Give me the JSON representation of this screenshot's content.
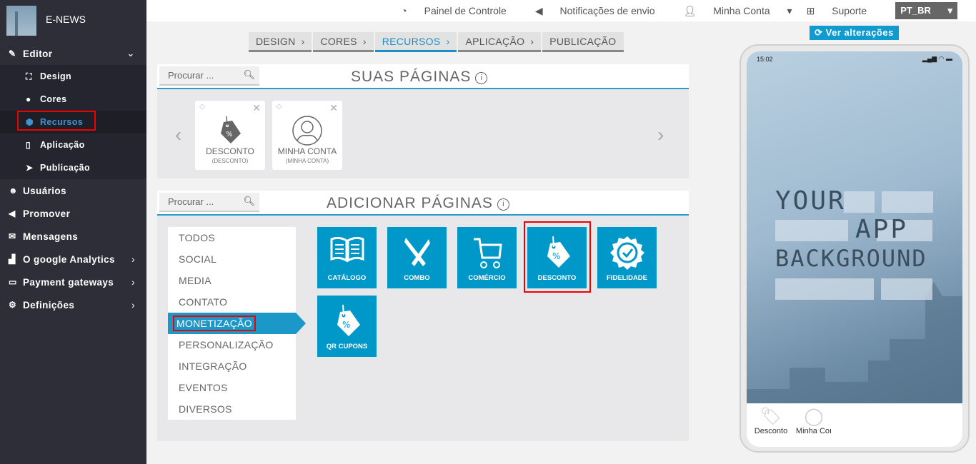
{
  "app": {
    "name": "E-NEWS"
  },
  "sidebar": {
    "items": [
      {
        "label": "Editor",
        "icon": "pencil-icon",
        "expanded": true,
        "children": [
          {
            "label": "Design",
            "icon": "crop-icon"
          },
          {
            "label": "Cores",
            "icon": "palette-icon"
          },
          {
            "label": "Recursos",
            "icon": "cube-icon",
            "active": true
          },
          {
            "label": "Aplicação",
            "icon": "mobile-icon"
          },
          {
            "label": "Publicação",
            "icon": "paper-plane-icon"
          }
        ]
      },
      {
        "label": "Usuários",
        "icon": "users-icon"
      },
      {
        "label": "Promover",
        "icon": "bullhorn-icon"
      },
      {
        "label": "Mensagens",
        "icon": "envelope-icon"
      },
      {
        "label": "O google Analytics",
        "icon": "bar-chart-icon",
        "chevron": true
      },
      {
        "label": "Payment gateways",
        "icon": "credit-card-icon",
        "chevron": true
      },
      {
        "label": "Definições",
        "icon": "cogs-icon",
        "chevron": true
      }
    ]
  },
  "topbar": {
    "panel": "Painel de Controle",
    "notifications": "Notificações de envio",
    "account": "Minha Conta",
    "support": "Suporte",
    "language": "PT_BR"
  },
  "breadcrumb": [
    "DESIGN",
    "CORES",
    "RECURSOS",
    "APLICAÇÃO",
    "PUBLICAÇÃO"
  ],
  "breadcrumb_active": "RECURSOS",
  "your_pages": {
    "title": "SUAS PÁGINAS",
    "search_placeholder": "Procurar ...",
    "pages": [
      {
        "title": "DESCONTO",
        "subtitle": "(DESCONTO)",
        "icon": "discount-tag-icon"
      },
      {
        "title": "MINHA CONTA",
        "subtitle": "(MINHA CONTA)",
        "icon": "user-circle-icon"
      }
    ]
  },
  "add_pages": {
    "title": "ADICIONAR PÁGINAS",
    "search_placeholder": "Procurar ...",
    "categories": [
      "TODOS",
      "SOCIAL",
      "MEDIA",
      "CONTATO",
      "MONETIZAÇÃO",
      "PERSONALIZAÇÃO",
      "INTEGRAÇÃO",
      "EVENTOS",
      "DIVERSOS"
    ],
    "active_category": "MONETIZAÇÃO",
    "tiles": [
      {
        "label": "CATÁLOGO",
        "icon": "book-icon"
      },
      {
        "label": "COMBO",
        "icon": "utensils-icon"
      },
      {
        "label": "COMÉRCIO",
        "icon": "cart-icon"
      },
      {
        "label": "DESCONTO",
        "icon": "discount-tag-icon",
        "selected": true
      },
      {
        "label": "FIDELIDADE",
        "icon": "badge-check-icon"
      },
      {
        "label": "QR CUPONS",
        "icon": "discount-tag-icon"
      }
    ]
  },
  "preview": {
    "button": "Ver alterações",
    "time": "15:02",
    "bg_lines": [
      "YOUR",
      "APP",
      "BACKGROUND"
    ],
    "tabs": [
      "Desconto",
      "Minha Coı"
    ]
  },
  "colors": {
    "accent": "#0098c8",
    "sidebar": "#2e2e38",
    "highlight": "#e00000"
  }
}
